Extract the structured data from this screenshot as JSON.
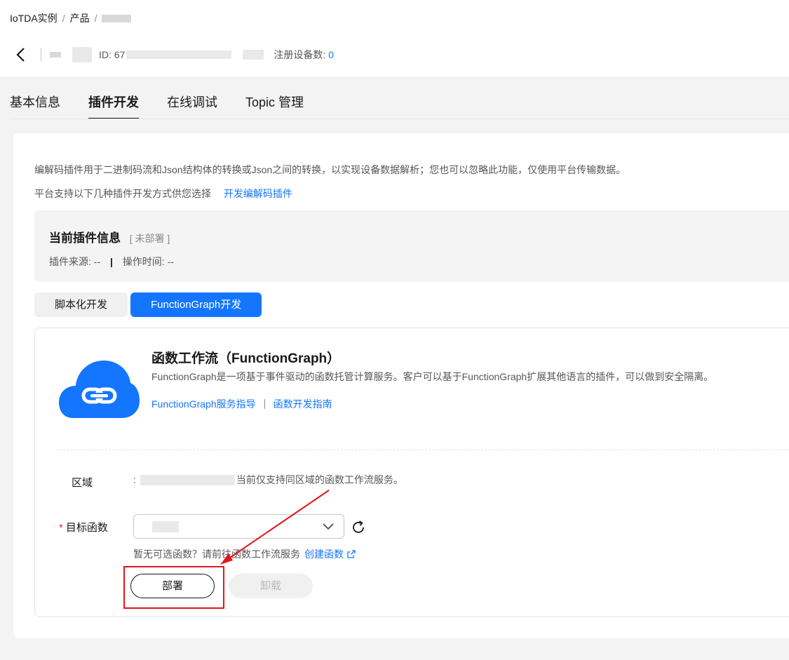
{
  "breadcrumb": {
    "root": "IoTDA实例",
    "sep": "/",
    "product": "产品"
  },
  "header": {
    "id_label": "ID: 67",
    "device_count_label": "注册设备数:",
    "device_count": "0"
  },
  "tabs": [
    {
      "label": "基本信息",
      "active": false
    },
    {
      "label": "插件开发",
      "active": true
    },
    {
      "label": "在线调试",
      "active": false
    },
    {
      "label": "Topic 管理",
      "active": false
    }
  ],
  "intro": {
    "line1": "编解码插件用于二进制码流和Json结构体的转换或Json之间的转换，以实现设备数据解析；您也可以忽略此功能，仅使用平台传输数据。",
    "line2": "平台支持以下几种插件开发方式供您选择",
    "line2_link": "开发编解码插件"
  },
  "plugin_info": {
    "title": "当前插件信息",
    "status": "[ 未部署 ]",
    "source_label": "插件来源: --",
    "divider": "|",
    "time_label": "操作时间: --"
  },
  "dev_modes": [
    {
      "label": "脚本化开发",
      "active": false
    },
    {
      "label": "FunctionGraph开发",
      "active": true
    }
  ],
  "functiongraph": {
    "title": "函数工作流（FunctionGraph）",
    "desc": "FunctionGraph是一项基于事件驱动的函数托管计算服务。客户可以基于FunctionGraph扩展其他语言的插件，可以做到安全隔离。",
    "link_guide": "FunctionGraph服务指导",
    "link_dev": "函数开发指南"
  },
  "form": {
    "region_label": "区域",
    "region_colon": ":",
    "region_note": "当前仅支持同区域的函数工作流服务。",
    "target_required": "*",
    "target_label": "目标函数",
    "hint_text": "暂无可选函数？请前往函数工作流服务",
    "hint_link": "创建函数"
  },
  "actions": {
    "deploy": "部署",
    "uninstall": "卸载"
  },
  "colors": {
    "primary": "#1476ff",
    "highlight": "#e3161c"
  },
  "icons": [
    "back-arrow-icon",
    "cloud-link-icon",
    "chevron-down-icon",
    "refresh-icon",
    "external-link-icon"
  ]
}
